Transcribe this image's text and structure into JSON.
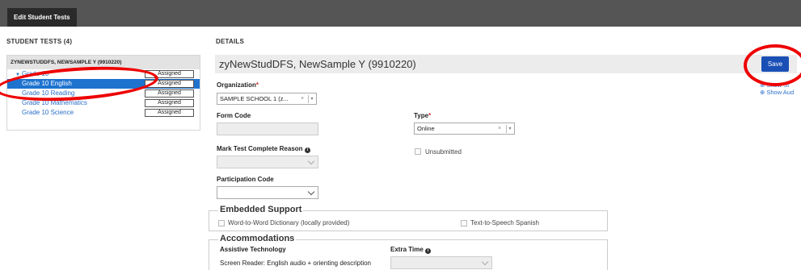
{
  "topbar": {
    "tab_label": "Edit Student Tests"
  },
  "left": {
    "title": "STUDENT TESTS (4)",
    "student_header": "ZYNEWSTUDDFS, NEWSAMPLE Y (9910220)",
    "group_label": "Grade 10",
    "group_status": "Assigned",
    "tests": [
      {
        "label": "Grade 10 English",
        "status": "Assigned"
      },
      {
        "label": "Grade 10 Reading",
        "status": "Assigned"
      },
      {
        "label": "Grade 10 Mathematics",
        "status": "Assigned"
      },
      {
        "label": "Grade 10 Science",
        "status": "Assigned"
      }
    ]
  },
  "details": {
    "title": "DETAILS",
    "student_name": "zyNewStudDFS, NewSample Y (9910220)",
    "save_label": "Save",
    "show_link_1": "Show St",
    "show_link_2": "Show Aud",
    "organization_label": "Organization",
    "organization_value": "SAMPLE SCHOOL 1 (z...",
    "form_code_label": "Form Code",
    "type_label": "Type",
    "type_value": "Online",
    "mark_complete_label": "Mark Test Complete Reason",
    "unsubmitted_label": "Unsubmitted",
    "participation_label": "Participation Code",
    "required_mark": "*",
    "info_glyph": "i",
    "clear_glyph": "×",
    "dropdown_glyph": "▾"
  },
  "embedded_support": {
    "legend": "Embedded Support",
    "item_1": "Word-to-Word Dictionary (locally provided)",
    "item_2": "Text-to-Speech Spanish"
  },
  "accommodations": {
    "legend": "Accommodations",
    "assistive_label": "Assistive Technology",
    "assistive_value": "Screen Reader: English audio + orienting description",
    "extra_time_label": "Extra Time"
  },
  "colors": {
    "accent": "#1e73cf",
    "save": "#1a4fb5",
    "topbar": "#555555",
    "annotation": "#ee0000"
  }
}
